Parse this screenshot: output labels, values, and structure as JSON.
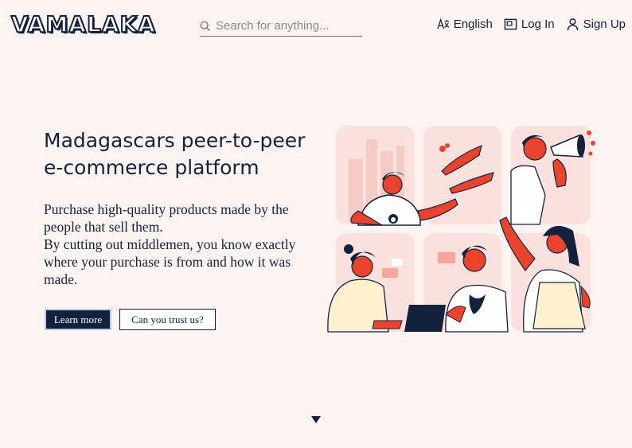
{
  "header": {
    "logo": "VAMALAKA",
    "search": {
      "placeholder": "Search for anything...",
      "value": ""
    },
    "nav": [
      {
        "label": "English",
        "icon": "language-icon"
      },
      {
        "label": "Log In",
        "icon": "login-icon"
      },
      {
        "label": "Sign Up",
        "icon": "user-icon"
      }
    ]
  },
  "hero": {
    "title": "Madagascars peer-to-peer e-commerce platform",
    "paragraph1": "Purchase high-quality products made by the people that sell them.",
    "paragraph2": "By cutting out middlemen, you know exactly where your purchase is from and how it was made.",
    "learn_more": "Learn more",
    "trust": "Can you trust us?"
  },
  "colors": {
    "background": "#fdf4f1",
    "navy": "#14213d",
    "accent": "#e8442e",
    "tile": "#fbe1de"
  }
}
